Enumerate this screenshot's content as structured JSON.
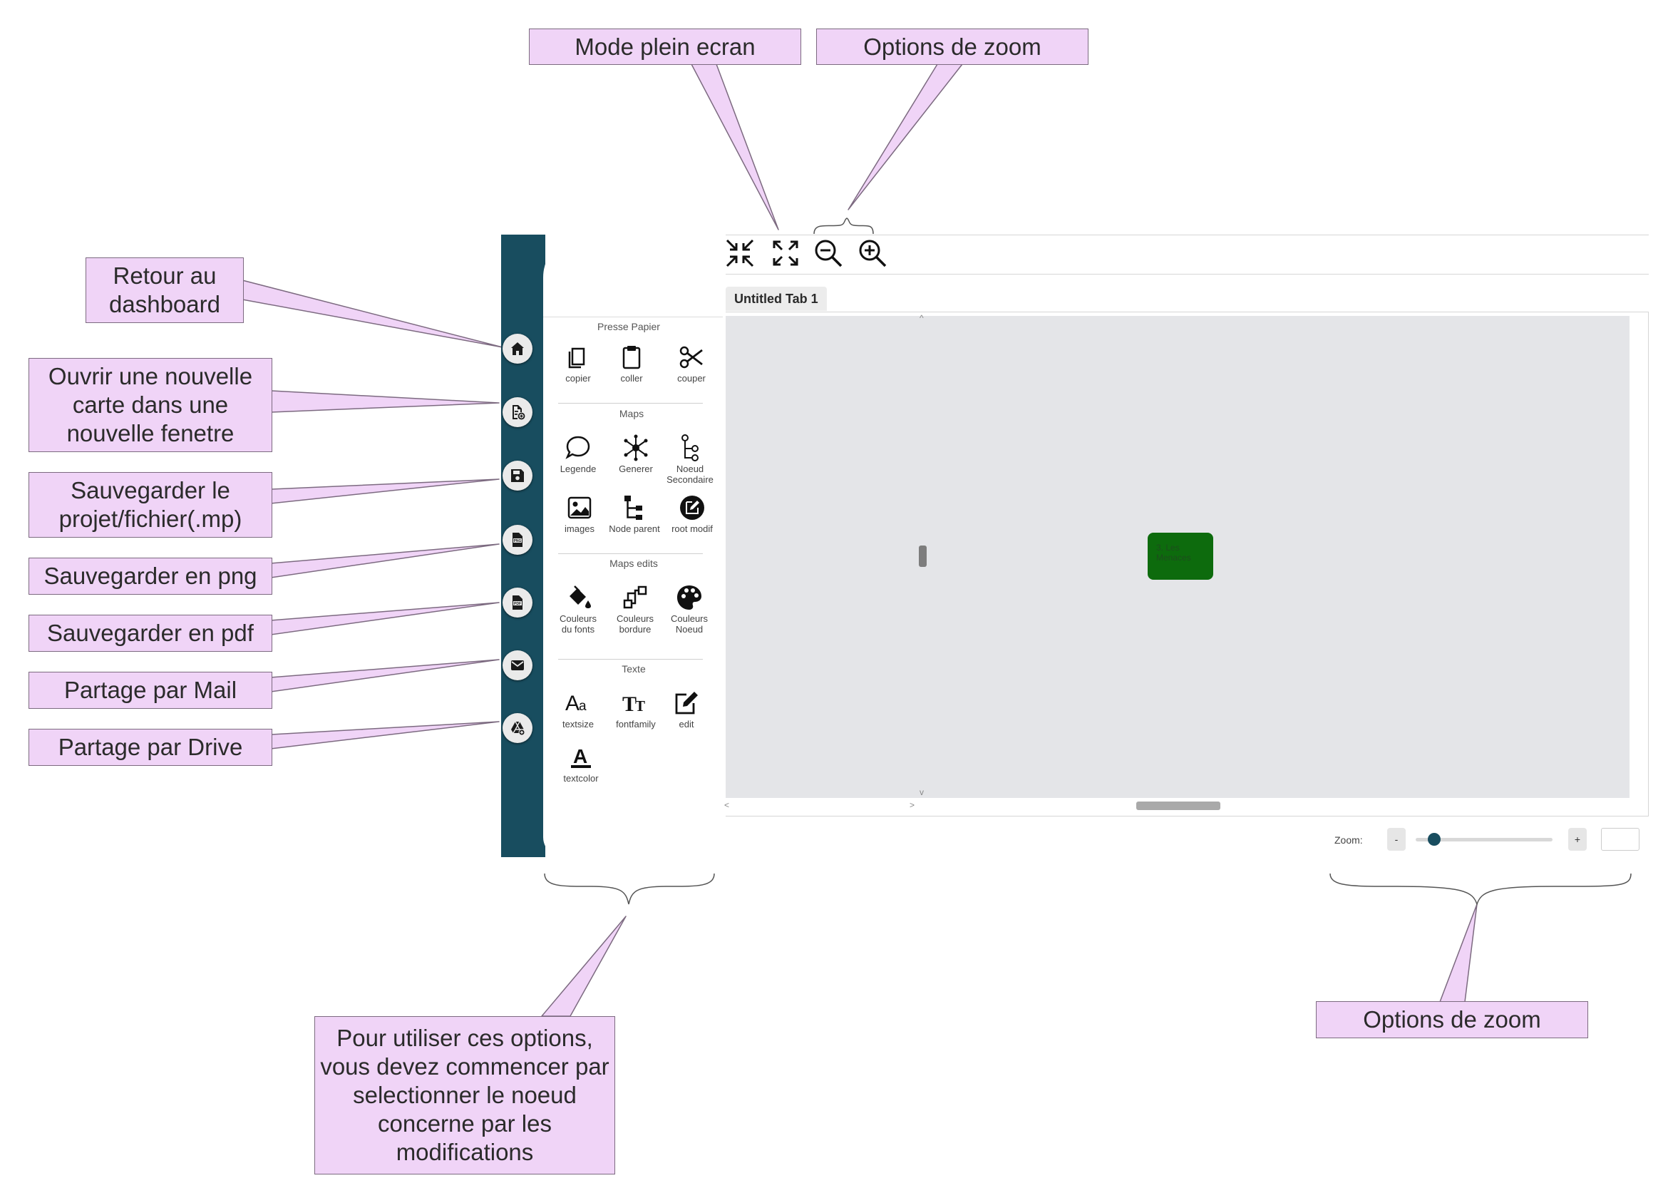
{
  "callouts": {
    "fullscreen": "Mode plein ecran",
    "zoom_top": "Options de zoom",
    "dashboard": "Retour au\ndashboard",
    "new_window": "Ouvrir une nouvelle\ncarte dans une\nnouvelle fenetre",
    "save_mp": "Sauvegarder le\nprojet/fichier(.mp)",
    "save_png": "Sauvegarder en png",
    "save_pdf": "Sauvegarder en pdf",
    "share_mail": "Partage par Mail",
    "share_drive": "Partage par Drive",
    "panel_hint": "Pour utiliser ces options,\nvous devez commencer par\nselectionner le noeud\nconcerne par les\nmodifications",
    "zoom_bottom": "Options de zoom"
  },
  "rail": {
    "items": [
      {
        "icon": "home-icon"
      },
      {
        "icon": "new-map-icon"
      },
      {
        "icon": "save-icon"
      },
      {
        "icon": "png-file-icon"
      },
      {
        "icon": "pdf-file-icon"
      },
      {
        "icon": "mail-icon"
      },
      {
        "icon": "drive-icon"
      }
    ]
  },
  "panel": {
    "sections": {
      "presse": "Presse Papier",
      "maps": "Maps",
      "maps_edits": "Maps edits",
      "texte": "Texte"
    },
    "tools": {
      "copier": "copier",
      "coller": "coller",
      "couper": "couper",
      "legende": "Legende",
      "generer": "Generer",
      "noeud_secondaire": "Noeud\nSecondaire",
      "images": "images",
      "node_parent": "Node parent",
      "root_modif": "root modif",
      "couleurs_fonts": "Couleurs\ndu fonts",
      "couleurs_bordure": "Couleurs\nbordure",
      "couleurs_noeud": "Couleurs\nNoeud",
      "textsize": "textsize",
      "fontfamily": "fontfamily",
      "edit": "edit",
      "textcolor": "textcolor"
    }
  },
  "tab": {
    "label": "Untitled Tab 1"
  },
  "node": {
    "label": "3. Les\nMenaces",
    "color": "#0d6b0d"
  },
  "zoom": {
    "label": "Zoom:",
    "minus": "-",
    "plus": "+",
    "level": 0.1
  },
  "colors": {
    "rail": "#184d5f",
    "callout_bg": "#f0d4f7",
    "canvas": "#e4e5e8"
  }
}
